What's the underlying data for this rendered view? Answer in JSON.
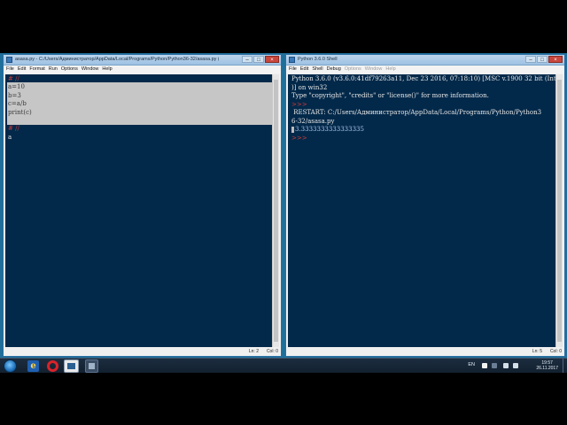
{
  "editor_window": {
    "title": "asasa.py - C:/Users/Администратор/AppData/Local/Programs/Python/Python36-32/asasa.py (3.6.0)",
    "menu": [
      "File",
      "Edit",
      "Format",
      "Run",
      "Options",
      "Window",
      "Help"
    ],
    "code_lines": [
      "# //",
      "a=10",
      "b=3",
      "c=a/b",
      "print(c)",
      "",
      "# //",
      "a"
    ],
    "status": {
      "ln": "Ln: 2",
      "col": "Col: 0"
    }
  },
  "shell_window": {
    "title": "Python 3.6.0 Shell",
    "menu": [
      "File",
      "Edit",
      "Shell",
      "Debug",
      "Options",
      "Window",
      "Help"
    ],
    "lines": [
      "Python 3.6.0 (v3.6.0:41df79263a11, Dec 23 2016, 07:18:10) [MSC v.1900 32 bit (Intel",
      ")] on win32",
      "Type \"copyright\", \"credits\" or \"license()\" for more information.",
      ">>>",
      " RESTART: C:/Users/Администратор/AppData/Local/Programs/Python/Python3",
      "6-32/asasa.py",
      "3.3333333333333335",
      ">>>"
    ],
    "status": {
      "ln": "Ln: 5",
      "col": "Col: 0"
    }
  },
  "window_buttons": {
    "minimize": "–",
    "maximize": "□",
    "close": "×"
  },
  "taskbar": {
    "lang": "EN",
    "time": "19:57",
    "date": "26.11.2017",
    "ie_glyph": "e"
  },
  "colors": {
    "editor_bg": "#03294a",
    "comment": "#c83a3a",
    "selection": "#c6c6c6",
    "output": "#a9c5e8"
  }
}
